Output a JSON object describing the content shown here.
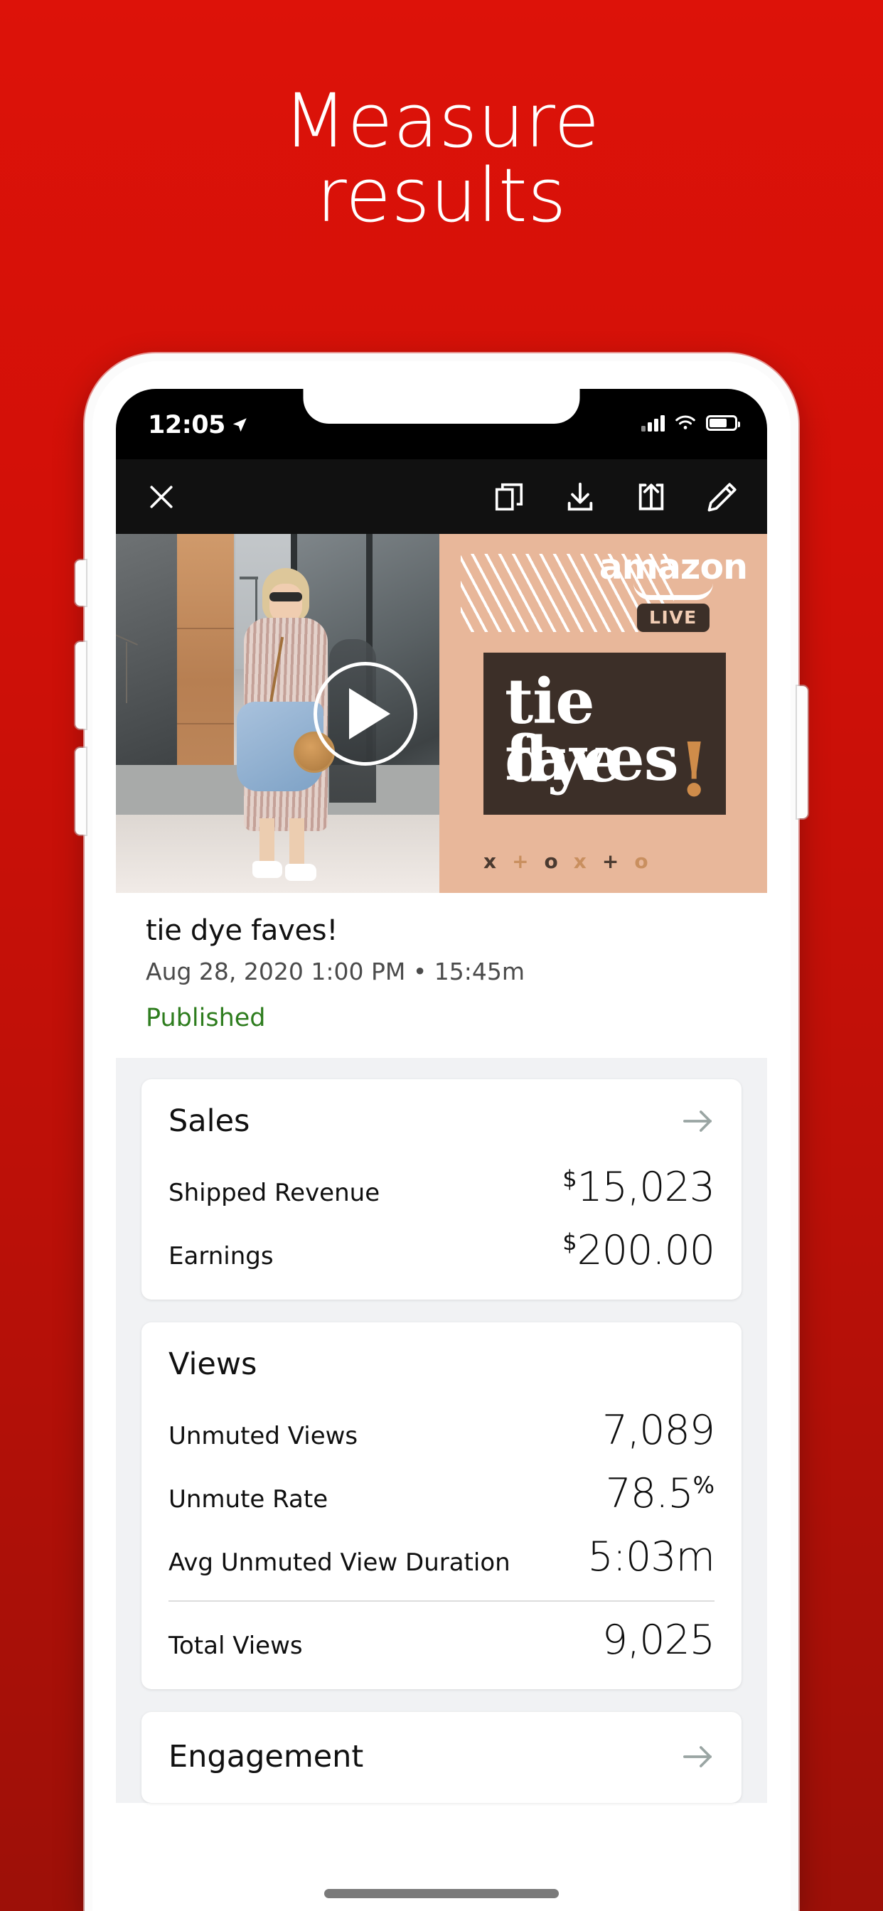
{
  "headline": {
    "line1": "Measure",
    "line2": "results"
  },
  "phone": {
    "status_bar": {
      "time": "12:05",
      "location_icon": "location-arrow-icon",
      "signal_icon": "cellular-bars-icon",
      "wifi_icon": "wifi-icon",
      "battery_icon": "battery-icon"
    },
    "toolbar": {
      "close_icon": "close-x-icon",
      "duplicate_icon": "duplicate-icon",
      "download_icon": "download-icon",
      "share_icon": "share-icon",
      "edit_icon": "pencil-edit-icon"
    }
  },
  "thumbnail": {
    "brand_word": "amazon",
    "brand_badge": "LIVE",
    "title_line1": "tie dye",
    "title_line2": "faves",
    "title_bang": "!",
    "decor_marks": [
      "x",
      "+",
      "o",
      "x",
      "+",
      "o"
    ],
    "play_icon": "play-button-icon",
    "accent_bg": "#e8b79a",
    "accent_box": "#3c2f28",
    "accent_orange": "#cf8c4a"
  },
  "meta": {
    "title": "tie dye faves!",
    "subtitle": "Aug 28, 2020 1:00 PM • 15:45m",
    "status": "Published",
    "status_color": "#2e7d1e"
  },
  "cards": {
    "sales": {
      "title": "Sales",
      "arrow_icon": "arrow-right-icon",
      "rows": [
        {
          "label": "Shipped Revenue",
          "prefix": "$",
          "value": "15,023",
          "suffix": ""
        },
        {
          "label": "Earnings",
          "prefix": "$",
          "value": "200.00",
          "suffix": ""
        }
      ]
    },
    "views": {
      "title": "Views",
      "rows": [
        {
          "label": "Unmuted Views",
          "prefix": "",
          "value": "7,089",
          "suffix": ""
        },
        {
          "label": "Unmute Rate",
          "prefix": "",
          "value": "78.5",
          "suffix": "%"
        },
        {
          "label": "Avg Unmuted View Duration",
          "prefix": "",
          "value": "5:03m",
          "suffix": ""
        }
      ],
      "total_row": {
        "label": "Total Views",
        "prefix": "",
        "value": "9,025",
        "suffix": ""
      }
    },
    "engagement": {
      "title": "Engagement",
      "arrow_icon": "arrow-right-icon"
    }
  },
  "theme": {
    "background_top": "#dd1209",
    "background_bottom": "#9d1008",
    "card_bg": "#f1f2f4"
  }
}
